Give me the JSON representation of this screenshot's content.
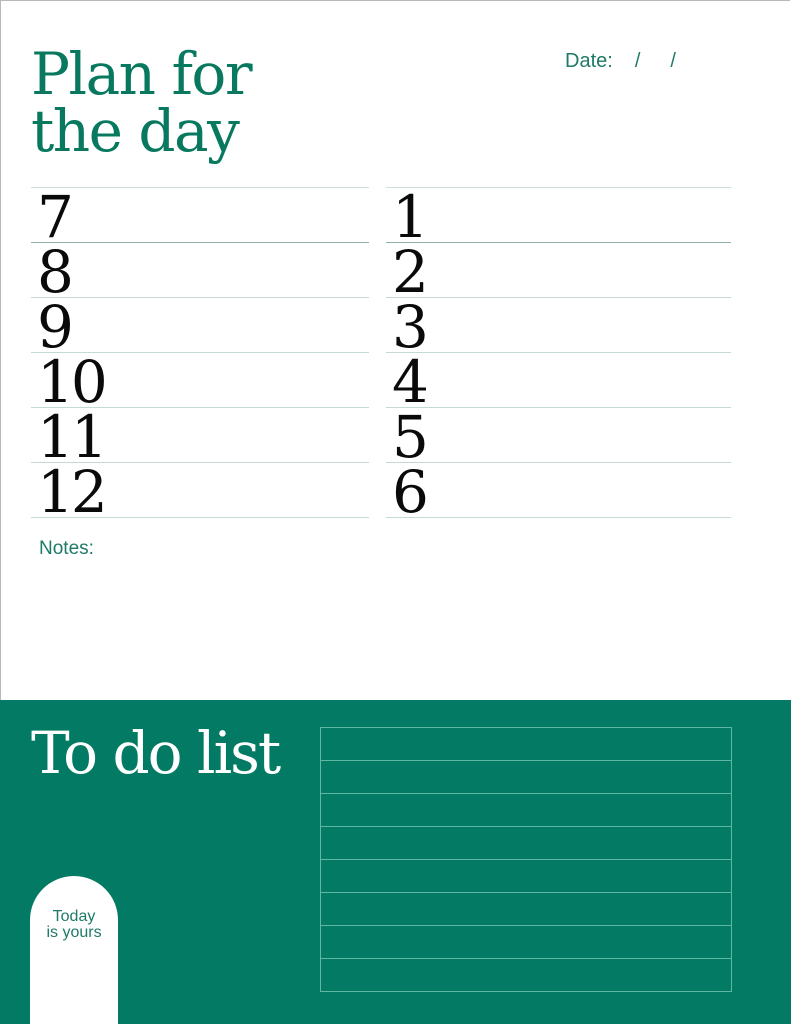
{
  "title": {
    "line1": "Plan for",
    "line2": "the day"
  },
  "date": {
    "label": "Date:",
    "separator": "/"
  },
  "schedule": {
    "morning_hours": [
      "7",
      "8",
      "9",
      "10",
      "11",
      "12"
    ],
    "afternoon_hours": [
      "1",
      "2",
      "3",
      "4",
      "5",
      "6"
    ]
  },
  "notes": {
    "label": "Notes:"
  },
  "todo": {
    "title": "To do list",
    "items": [
      "",
      "",
      "",
      "",
      "",
      "",
      "",
      ""
    ]
  },
  "badge": {
    "line1": "Today",
    "line2": "is yours"
  },
  "colors": {
    "brand_green": "#037a63",
    "text_green": "#1f7a66",
    "rule": "#c5d9d5"
  }
}
